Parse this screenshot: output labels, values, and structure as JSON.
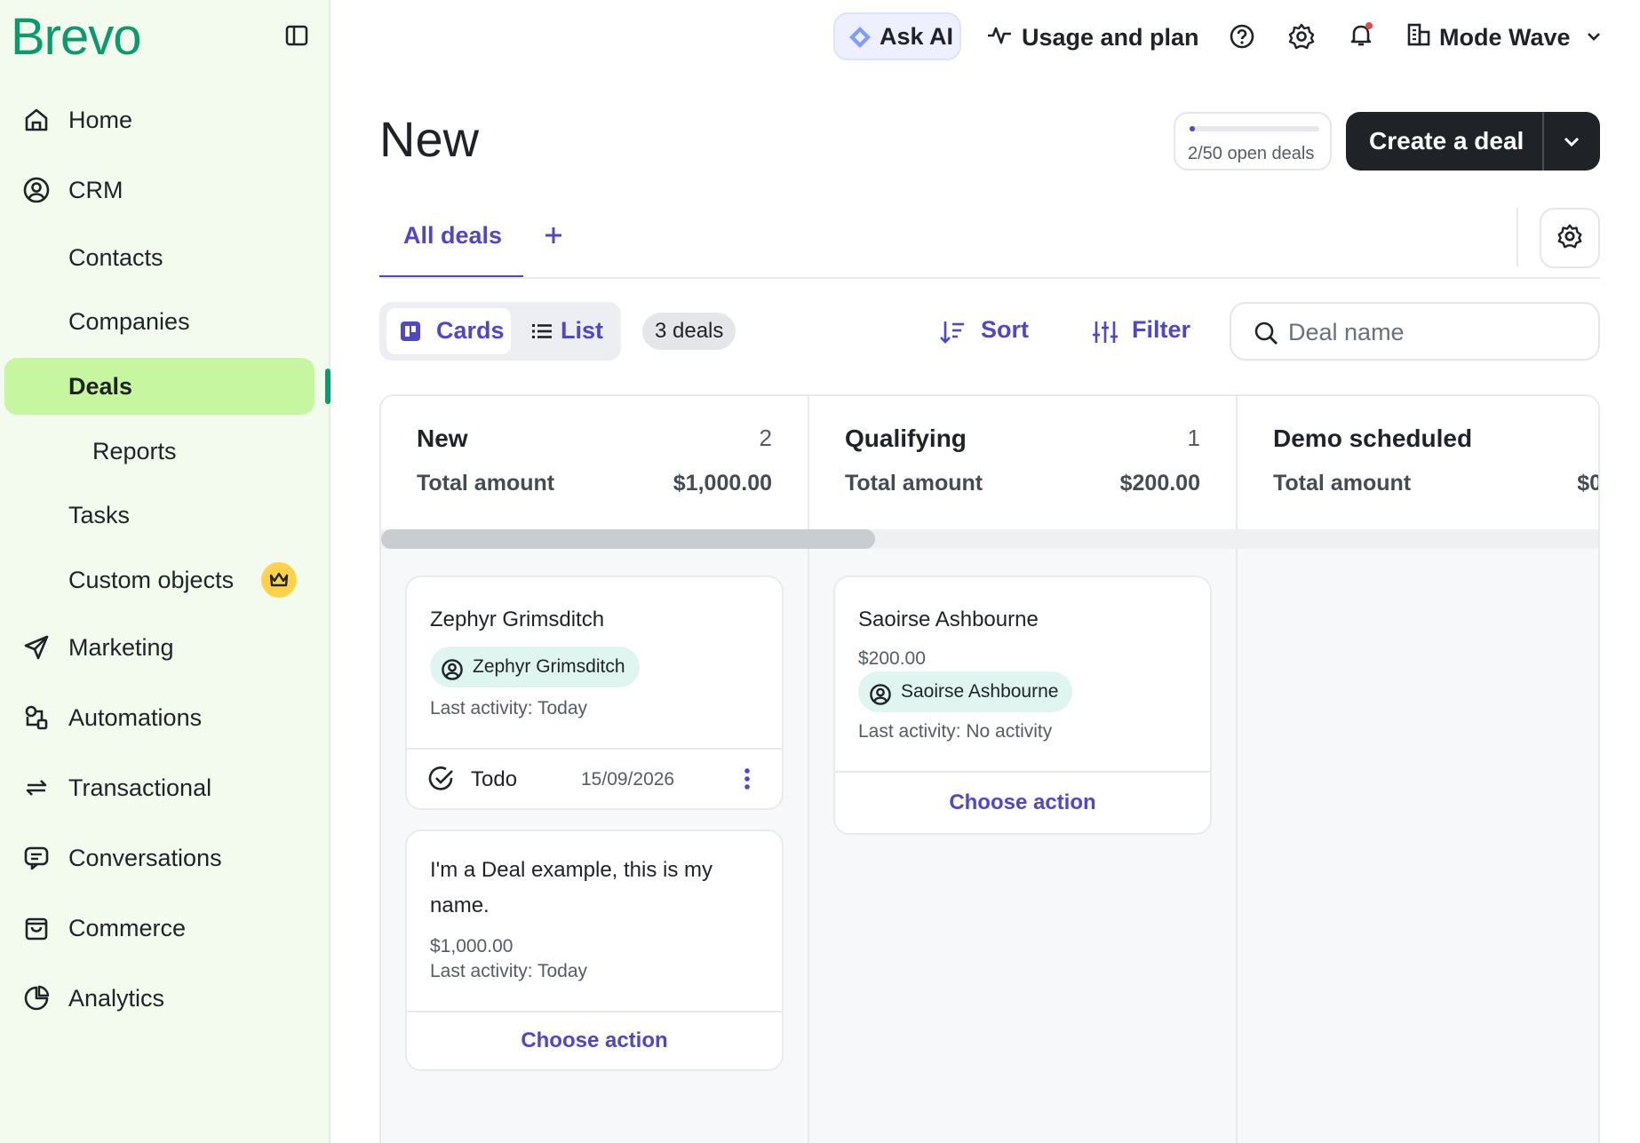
{
  "sidebar": {
    "logo": "Brevo",
    "items": [
      {
        "label": "Home"
      },
      {
        "label": "CRM"
      },
      {
        "label": "Contacts"
      },
      {
        "label": "Companies"
      },
      {
        "label": "Deals"
      },
      {
        "label": "Reports"
      },
      {
        "label": "Tasks"
      },
      {
        "label": "Custom objects"
      },
      {
        "label": "Marketing"
      },
      {
        "label": "Automations"
      },
      {
        "label": "Transactional"
      },
      {
        "label": "Conversations"
      },
      {
        "label": "Commerce"
      },
      {
        "label": "Analytics"
      }
    ]
  },
  "topbar": {
    "ask_ai": "Ask AI",
    "usage": "Usage and plan",
    "account": "Mode Wave"
  },
  "page": {
    "title": "New",
    "open_deals_text": "2/50 open deals",
    "open_deals_fraction": 0.04,
    "create_button": "Create a deal"
  },
  "tabs": {
    "active": "All deals"
  },
  "toolbar": {
    "cards": "Cards",
    "list": "List",
    "deals_count": "3 deals",
    "sort": "Sort",
    "filter": "Filter",
    "search_placeholder": "Deal name"
  },
  "board": {
    "columns": [
      {
        "name": "New",
        "count": "2",
        "amount_label": "Total amount",
        "amount": "$1,000.00"
      },
      {
        "name": "Qualifying",
        "count": "1",
        "amount_label": "Total amount",
        "amount": "$200.00"
      },
      {
        "name": "Demo scheduled",
        "count": "",
        "amount_label": "Total amount",
        "amount": "$0"
      }
    ],
    "cards": {
      "c1": {
        "title": "Zephyr Grimsditch",
        "contact": "Zephyr Grimsditch",
        "last_activity": "Last activity: Today",
        "todo_label": "Todo",
        "todo_date": "15/09/2026"
      },
      "c2": {
        "title": "I'm a Deal example, this is my name.",
        "amount": "$1,000.00",
        "last_activity": "Last activity: Today",
        "action": "Choose action"
      },
      "c3": {
        "title": "Saoirse Ashbourne",
        "amount": "$200.00",
        "contact": "Saoirse Ashbourne",
        "last_activity": "Last activity: No activity",
        "action": "Choose action"
      }
    }
  },
  "colors": {
    "brand": "#0b996e",
    "accent": "#4f46c8",
    "active_nav": "#c7f6a0",
    "sidebar_bg": "#f2fbee"
  }
}
